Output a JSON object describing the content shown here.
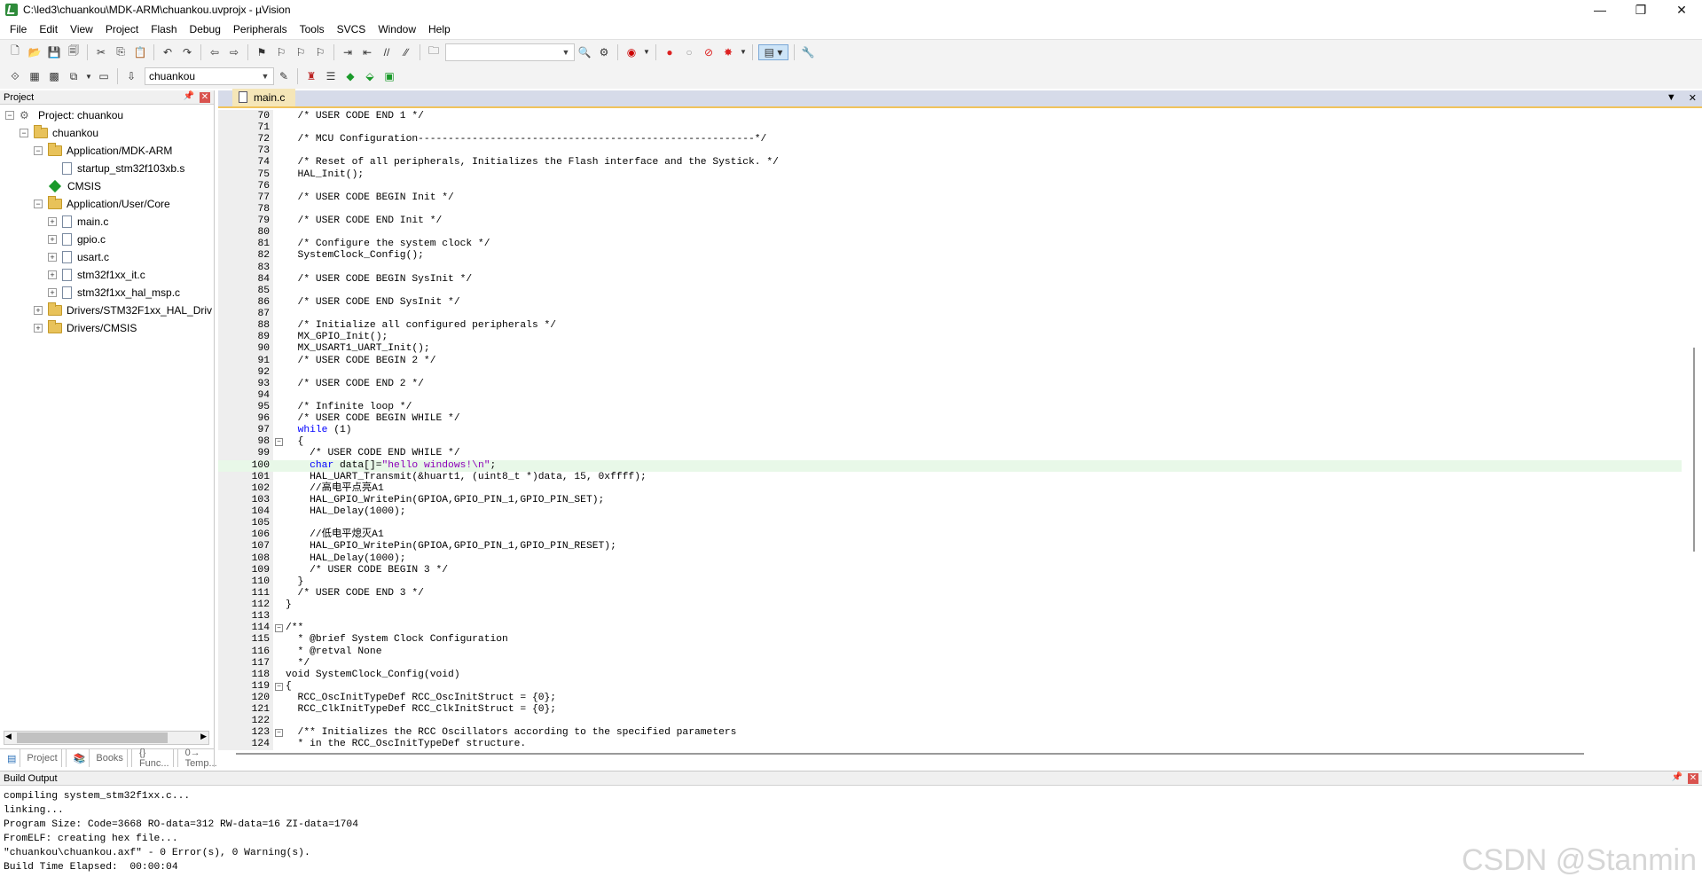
{
  "window": {
    "title": "C:\\led3\\chuankou\\MDK-ARM\\chuankou.uvprojx - µVision",
    "controls": [
      "—",
      "❐",
      "✕"
    ]
  },
  "menu": [
    "File",
    "Edit",
    "View",
    "Project",
    "Flash",
    "Debug",
    "Peripherals",
    "Tools",
    "SVCS",
    "Window",
    "Help"
  ],
  "toolbar2": {
    "target": "chuankou"
  },
  "project_panel": {
    "title": "Project",
    "tree": [
      {
        "label": "Project: chuankou",
        "depth": 0,
        "type": "project",
        "exp": "−"
      },
      {
        "label": "chuankou",
        "depth": 1,
        "type": "folder",
        "exp": "−"
      },
      {
        "label": "Application/MDK-ARM",
        "depth": 2,
        "type": "folder",
        "exp": "−"
      },
      {
        "label": "startup_stm32f103xb.s",
        "depth": 3,
        "type": "file",
        "exp": ""
      },
      {
        "label": "CMSIS",
        "depth": 2,
        "type": "diamond",
        "exp": ""
      },
      {
        "label": "Application/User/Core",
        "depth": 2,
        "type": "folder",
        "exp": "−"
      },
      {
        "label": "main.c",
        "depth": 3,
        "type": "file",
        "exp": "+"
      },
      {
        "label": "gpio.c",
        "depth": 3,
        "type": "file",
        "exp": "+"
      },
      {
        "label": "usart.c",
        "depth": 3,
        "type": "file",
        "exp": "+"
      },
      {
        "label": "stm32f1xx_it.c",
        "depth": 3,
        "type": "file",
        "exp": "+"
      },
      {
        "label": "stm32f1xx_hal_msp.c",
        "depth": 3,
        "type": "file",
        "exp": "+"
      },
      {
        "label": "Drivers/STM32F1xx_HAL_Driv",
        "depth": 2,
        "type": "folder",
        "exp": "+"
      },
      {
        "label": "Drivers/CMSIS",
        "depth": 2,
        "type": "folder",
        "exp": "+"
      }
    ],
    "tabs": [
      "Project",
      "Books",
      "{} Func...",
      "0→ Temp..."
    ]
  },
  "editor": {
    "tab": "main.c",
    "current_line": 100,
    "lines": [
      {
        "n": 70,
        "t": "  /* USER CODE END 1 */",
        "c": "cm"
      },
      {
        "n": 71,
        "t": "",
        "c": ""
      },
      {
        "n": 72,
        "t": "  /* MCU Configuration--------------------------------------------------------*/",
        "c": "cm"
      },
      {
        "n": 73,
        "t": "",
        "c": ""
      },
      {
        "n": 74,
        "t": "  /* Reset of all peripherals, Initializes the Flash interface and the Systick. */",
        "c": "cm"
      },
      {
        "n": 75,
        "t": "  HAL_Init();",
        "c": ""
      },
      {
        "n": 76,
        "t": "",
        "c": ""
      },
      {
        "n": 77,
        "t": "  /* USER CODE BEGIN Init */",
        "c": "cm"
      },
      {
        "n": 78,
        "t": "",
        "c": ""
      },
      {
        "n": 79,
        "t": "  /* USER CODE END Init */",
        "c": "cm"
      },
      {
        "n": 80,
        "t": "",
        "c": ""
      },
      {
        "n": 81,
        "t": "  /* Configure the system clock */",
        "c": "cm"
      },
      {
        "n": 82,
        "t": "  SystemClock_Config();",
        "c": ""
      },
      {
        "n": 83,
        "t": "",
        "c": ""
      },
      {
        "n": 84,
        "t": "  /* USER CODE BEGIN SysInit */",
        "c": "cm"
      },
      {
        "n": 85,
        "t": "",
        "c": ""
      },
      {
        "n": 86,
        "t": "  /* USER CODE END SysInit */",
        "c": "cm"
      },
      {
        "n": 87,
        "t": "",
        "c": ""
      },
      {
        "n": 88,
        "t": "  /* Initialize all configured peripherals */",
        "c": "cm"
      },
      {
        "n": 89,
        "t": "  MX_GPIO_Init();",
        "c": ""
      },
      {
        "n": 90,
        "t": "  MX_USART1_UART_Init();",
        "c": ""
      },
      {
        "n": 91,
        "t": "  /* USER CODE BEGIN 2 */",
        "c": "cm"
      },
      {
        "n": 92,
        "t": "",
        "c": ""
      },
      {
        "n": 93,
        "t": "  /* USER CODE END 2 */",
        "c": "cm"
      },
      {
        "n": 94,
        "t": "",
        "c": ""
      },
      {
        "n": 95,
        "t": "  /* Infinite loop */",
        "c": "cm"
      },
      {
        "n": 96,
        "t": "  /* USER CODE BEGIN WHILE */",
        "c": "cm"
      },
      {
        "n": 97,
        "t": "  while (1)",
        "c": "kw"
      },
      {
        "n": 98,
        "t": "  {",
        "c": "",
        "fold": "−"
      },
      {
        "n": 99,
        "t": "    /* USER CODE END WHILE */",
        "c": "cm"
      },
      {
        "n": 100,
        "t": "    char data[]=\"hello windows!\\n\";",
        "c": "mix"
      },
      {
        "n": 101,
        "t": "    HAL_UART_Transmit(&huart1, (uint8_t *)data, 15, 0xffff);",
        "c": ""
      },
      {
        "n": 102,
        "t": "    //高电平点亮A1",
        "c": "cm"
      },
      {
        "n": 103,
        "t": "    HAL_GPIO_WritePin(GPIOA,GPIO_PIN_1,GPIO_PIN_SET);",
        "c": ""
      },
      {
        "n": 104,
        "t": "    HAL_Delay(1000);",
        "c": ""
      },
      {
        "n": 105,
        "t": "",
        "c": ""
      },
      {
        "n": 106,
        "t": "    //低电平熄灭A1",
        "c": "cm"
      },
      {
        "n": 107,
        "t": "    HAL_GPIO_WritePin(GPIOA,GPIO_PIN_1,GPIO_PIN_RESET);",
        "c": ""
      },
      {
        "n": 108,
        "t": "    HAL_Delay(1000);",
        "c": ""
      },
      {
        "n": 109,
        "t": "    /* USER CODE BEGIN 3 */",
        "c": "cm"
      },
      {
        "n": 110,
        "t": "  }",
        "c": ""
      },
      {
        "n": 111,
        "t": "  /* USER CODE END 3 */",
        "c": "cm"
      },
      {
        "n": 112,
        "t": "}",
        "c": ""
      },
      {
        "n": 113,
        "t": "",
        "c": ""
      },
      {
        "n": 114,
        "t": "/**",
        "c": "cm",
        "fold": "−"
      },
      {
        "n": 115,
        "t": "  * @brief System Clock Configuration",
        "c": "cm"
      },
      {
        "n": 116,
        "t": "  * @retval None",
        "c": "cm"
      },
      {
        "n": 117,
        "t": "  */",
        "c": "cm"
      },
      {
        "n": 118,
        "t": "void SystemClock_Config(void)",
        "c": ""
      },
      {
        "n": 119,
        "t": "{",
        "c": "",
        "fold": "−"
      },
      {
        "n": 120,
        "t": "  RCC_OscInitTypeDef RCC_OscInitStruct = {0};",
        "c": ""
      },
      {
        "n": 121,
        "t": "  RCC_ClkInitTypeDef RCC_ClkInitStruct = {0};",
        "c": ""
      },
      {
        "n": 122,
        "t": "",
        "c": ""
      },
      {
        "n": 123,
        "t": "  /** Initializes the RCC Oscillators according to the specified parameters",
        "c": "cm",
        "fold": "−"
      },
      {
        "n": 124,
        "t": "  * in the RCC_OscInitTypeDef structure.",
        "c": "cm"
      }
    ]
  },
  "build_output": {
    "title": "Build Output",
    "lines": [
      "compiling system_stm32f1xx.c...",
      "linking...",
      "Program Size: Code=3668 RO-data=312 RW-data=16 ZI-data=1704",
      "FromELF: creating hex file...",
      "\"chuankou\\chuankou.axf\" - 0 Error(s), 0 Warning(s).",
      "Build Time Elapsed:  00:00:04"
    ]
  },
  "watermark": "CSDN @Stanmin"
}
